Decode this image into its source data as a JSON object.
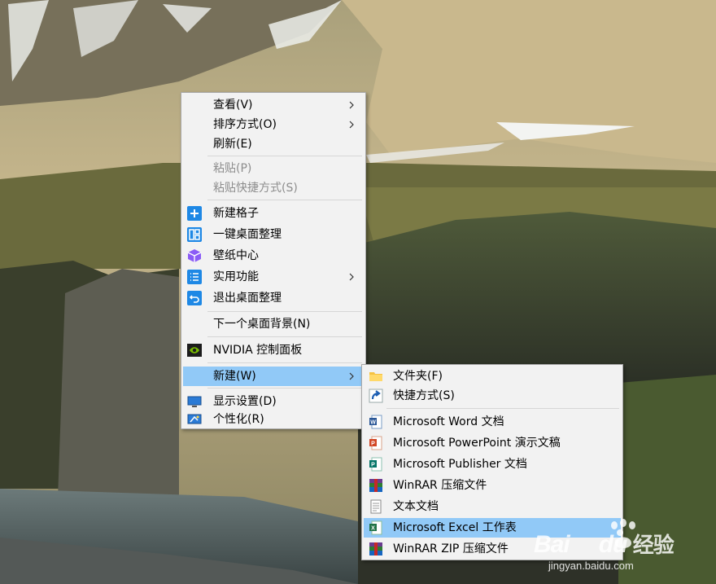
{
  "context_menu": {
    "groups": [
      {
        "items": [
          {
            "label": "查看(V)",
            "submenu": true
          },
          {
            "label": "排序方式(O)",
            "submenu": true
          },
          {
            "label": "刷新(E)",
            "submenu": false
          }
        ]
      },
      {
        "items": [
          {
            "label": "粘贴(P)",
            "disabled": true
          },
          {
            "label": "粘贴快捷方式(S)",
            "disabled": true
          }
        ]
      },
      {
        "items": [
          {
            "label": "新建格子",
            "icon": "add-square-icon"
          },
          {
            "label": "一键桌面整理",
            "icon": "layout-grid-icon"
          },
          {
            "label": "壁纸中心",
            "icon": "cube-icon"
          },
          {
            "label": "实用功能",
            "icon": "list-icon",
            "submenu": true
          },
          {
            "label": "退出桌面整理",
            "icon": "exit-icon"
          }
        ]
      },
      {
        "items": [
          {
            "label": "下一个桌面背景(N)"
          }
        ]
      },
      {
        "items": [
          {
            "label": "NVIDIA 控制面板",
            "icon": "nvidia-icon"
          }
        ]
      },
      {
        "items": [
          {
            "label": "新建(W)",
            "submenu": true,
            "highlighted": true
          }
        ]
      },
      {
        "items": [
          {
            "label": "显示设置(D)",
            "icon": "display-icon"
          },
          {
            "label": "个性化(R)",
            "icon": "personalize-icon"
          }
        ]
      }
    ]
  },
  "new_submenu": {
    "items": [
      {
        "label": "文件夹(F)",
        "icon": "folder-icon"
      },
      {
        "label": "快捷方式(S)",
        "icon": "shortcut-icon"
      },
      {
        "label": "Microsoft Word 文档",
        "icon": "word-doc-icon"
      },
      {
        "label": "Microsoft PowerPoint 演示文稿",
        "icon": "powerpoint-icon"
      },
      {
        "label": "Microsoft Publisher 文档",
        "icon": "publisher-icon"
      },
      {
        "label": "WinRAR 压缩文件",
        "icon": "winrar-icon"
      },
      {
        "label": "文本文档",
        "icon": "text-file-icon"
      },
      {
        "label": "Microsoft Excel 工作表",
        "icon": "excel-icon",
        "highlighted": true
      },
      {
        "label": "WinRAR ZIP 压缩文件",
        "icon": "winrar-zip-icon"
      }
    ]
  },
  "watermark": {
    "brand": "Bai",
    "brand2": "du",
    "sub": "经验",
    "url": "jingyan.baidu.com"
  },
  "colors": {
    "menu_bg": "#f2f2f2",
    "highlight": "#91c9f7",
    "accent_blue": "#1e88e5"
  }
}
